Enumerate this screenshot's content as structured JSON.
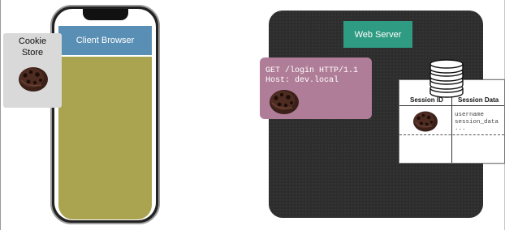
{
  "client": {
    "browser_label": "Client Browser"
  },
  "cookie_store": {
    "label_line1": "Cookie",
    "label_line2": "Store"
  },
  "server": {
    "label": "Web Server"
  },
  "request": {
    "line1": "GET /login HTTP/1.1",
    "line2": "Host: dev.local"
  },
  "session_table": {
    "col1_header": "Session ID",
    "col2_header": "Session Data",
    "row1": [
      "username",
      "session_data",
      "..."
    ]
  },
  "colors": {
    "browser_bar": "#5a8fb5",
    "browser_body": "#aaa34f",
    "server_label": "#2f9b82",
    "request_box": "#b07d98",
    "server_bg": "#2d2d2d",
    "cookie_store_bg": "#d9d9d9"
  },
  "icons": [
    "cookie-icon",
    "database-icon"
  ]
}
